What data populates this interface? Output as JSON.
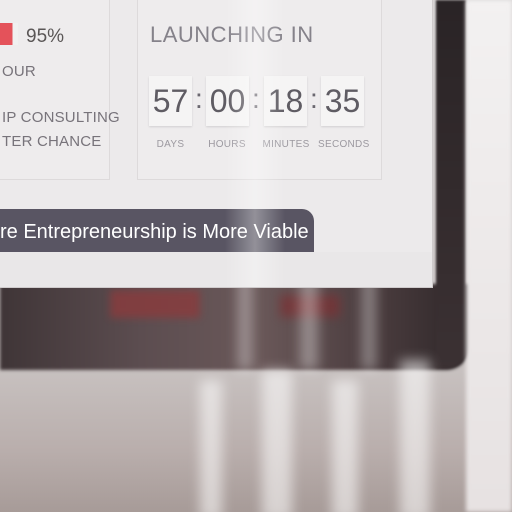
{
  "progress": {
    "fill": 0.7,
    "percent_label": "95%",
    "bar_color": "#e4525a"
  },
  "left_card": {
    "line1": "OUR",
    "line2": "IP CONSULTING",
    "line3": "TER CHANCE"
  },
  "countdown": {
    "title": "LAUNCHING IN",
    "days": "57",
    "hours": "00",
    "minutes": "18",
    "seconds": "35",
    "separator": ":",
    "labels": {
      "days": "DAYS",
      "hours": "HOURS",
      "minutes": "MINUTES",
      "seconds": "SECONDS"
    }
  },
  "banner": {
    "text": "re Entrepreneurship is More Viable",
    "color": "#595563"
  }
}
